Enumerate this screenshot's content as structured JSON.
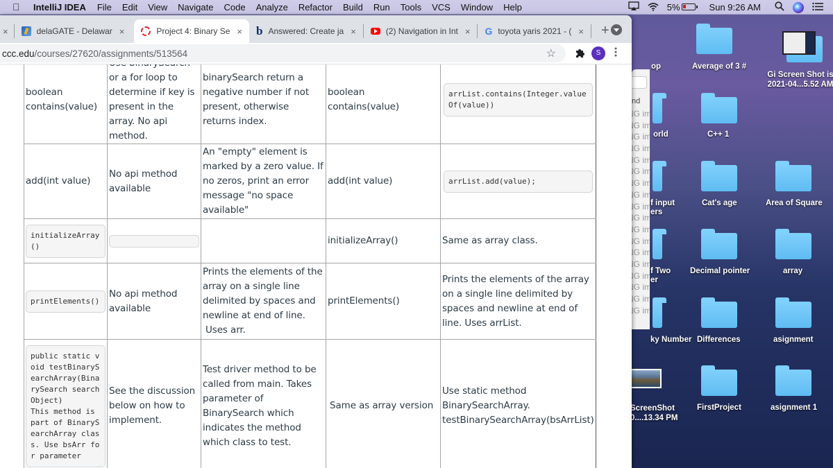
{
  "menubar": {
    "app_name": "IntelliJ IDEA",
    "menus": [
      "File",
      "Edit",
      "View",
      "Navigate",
      "Code",
      "Analyze",
      "Refactor",
      "Build",
      "Run",
      "Tools",
      "VCS",
      "Window",
      "Help"
    ],
    "battery": "5%",
    "clock": "Sun 9:26 AM"
  },
  "browser": {
    "tabs": [
      {
        "label": "delaGATE - Delawar",
        "icon": "delagate-icon",
        "active": false
      },
      {
        "label": "Project 4: Binary Se",
        "icon": "canvas-icon",
        "active": true
      },
      {
        "label": "Answered: Create ja",
        "icon": "bartleby-icon",
        "active": false
      },
      {
        "label": "(2) Navigation in Int",
        "icon": "youtube-icon",
        "active": false
      },
      {
        "label": "toyota yaris 2021 - (",
        "icon": "google-icon",
        "active": false
      }
    ],
    "first_tab_close": "×",
    "new_tab": "+",
    "url_host": "ccc.edu",
    "url_path": "/courses/27620/assignments/513564",
    "profile_initial": "S"
  },
  "table": {
    "rows": [
      {
        "method": "boolean contains(value)",
        "array_impl": "Use binarySearch or a for loop to determine if key is present in the array. No api method.",
        "array_notes": "binarySearch return a negative number if not present, otherwise returns index.",
        "list_method": "boolean contains(value)",
        "list_impl_code": "arrList.contains(Integer.valueOf(value))"
      },
      {
        "method": "add(int value)",
        "array_impl": "No api method available",
        "array_notes": "An \"empty\" element is marked by a zero value.  If no zeros, print an error message \"no space available\"",
        "list_method": "add(int value)",
        "list_impl_code": "arrList.add(value);"
      },
      {
        "method_code": "initializeArray()",
        "array_impl_code": "",
        "array_notes": "",
        "list_method": "initializeArray()",
        "list_impl": "Same as array class."
      },
      {
        "method_code": "printElements()",
        "array_impl": "No api method available",
        "array_notes": "Prints the elements of the array on a single line delimited by spaces and newline at end of line.",
        "array_notes_extra": "Uses arr.",
        "list_method": "printElements()",
        "list_impl": "Prints the elements of the array on a single line delimited by spaces and newline at end of line.   Uses arrList."
      },
      {
        "method_code": "public static void testBinarySearchArray(BinarySearch searchObject)",
        "method_code_note": "This method is part of BinarySearchArray class. Use bsArr for parameter",
        "array_impl": "See the discussion below on how to implement.",
        "array_notes": "Test driver method to be called from main.  Takes parameter of BinarySearch which indicates the method which class to test.",
        "list_method": "Same as array version",
        "list_impl": "Use static method BinarySearchArray. testBinarySearchArray(bsArrList)"
      }
    ]
  },
  "finder": {
    "column_header": "nd",
    "row_label": "NG ima",
    "row_count": 18
  },
  "desktop": {
    "items": [
      {
        "label": "op"
      },
      {
        "label": "Average of 3 #"
      },
      {
        "label": "Gi Screen Shot is 2021-04...5.52 AM"
      },
      {
        "label": "orld"
      },
      {
        "label": "C++ 1"
      },
      {
        "label": "f input ers"
      },
      {
        "label": "Cat's age"
      },
      {
        "label": "Area of Square"
      },
      {
        "label": "f Two er"
      },
      {
        "label": "Decimal pointer"
      },
      {
        "label": "array"
      },
      {
        "label": "ky Number"
      },
      {
        "label": "Differences"
      },
      {
        "label": "asignment"
      },
      {
        "label": "ScreenShot 0....13.34 PM"
      },
      {
        "label": "FirstProject"
      },
      {
        "label": "asignment 1"
      }
    ]
  }
}
